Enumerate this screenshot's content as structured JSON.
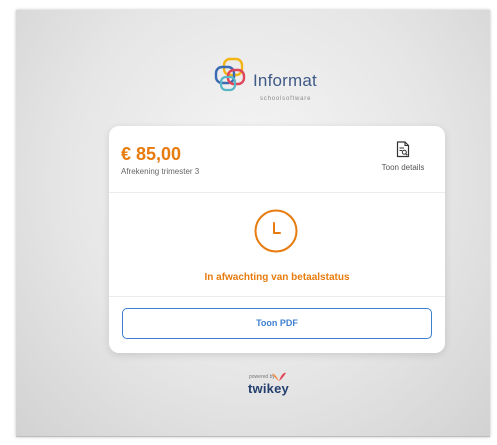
{
  "brand": {
    "name": "Informat",
    "tagline": "schoolsoftware"
  },
  "invoice": {
    "amount": "€ 85,00",
    "description": "Afrekening trimester 3",
    "details_label": "Toon details",
    "status": "In afwachting van betaalstatus",
    "pdf_label": "Toon PDF"
  },
  "footer": {
    "powered_by": "powered by",
    "provider": "twikey"
  },
  "colors": {
    "accent": "#e77b0e",
    "button": "#3e7fd0",
    "brand_text": "#3f5a86",
    "provider": "#243f6e"
  },
  "icons": {
    "status": "clock-icon",
    "details": "document-search-icon",
    "brand": "informat-logo",
    "provider": "twikey-butterfly-icon"
  }
}
